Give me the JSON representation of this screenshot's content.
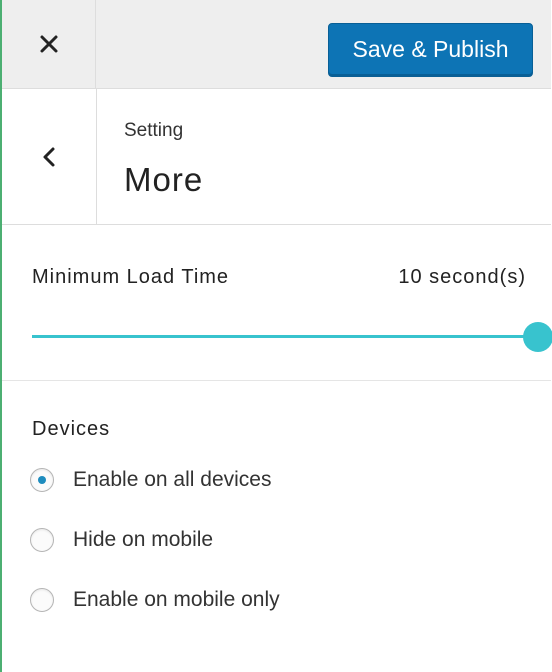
{
  "header": {
    "close_icon": "close-icon",
    "publish_label": "Save & Publish",
    "publish_color": "#0d74b5"
  },
  "section": {
    "back_icon": "chevron-left-icon",
    "breadcrumb": "Setting",
    "title": "More"
  },
  "min_load_time": {
    "label": "Minimum Load Time",
    "value_text": "10 second(s)",
    "value": 10,
    "min": 0,
    "max": 10,
    "accent_color": "#38c3ce"
  },
  "devices": {
    "label": "Devices",
    "options": [
      {
        "label": "Enable on all devices",
        "checked": true
      },
      {
        "label": "Hide on mobile",
        "checked": false
      },
      {
        "label": "Enable on mobile only",
        "checked": false
      }
    ]
  }
}
